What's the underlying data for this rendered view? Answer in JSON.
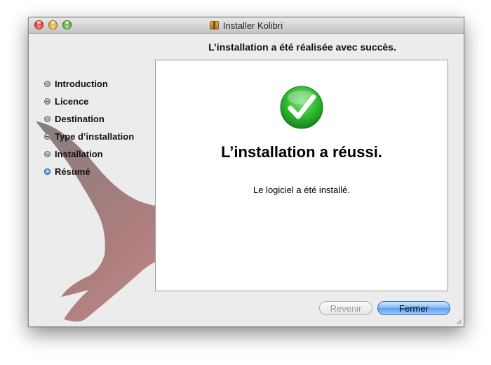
{
  "window": {
    "title": "Installer Kolibri",
    "title_icon": "package-icon"
  },
  "header": {
    "text": "L’installation a été réalisée avec succès."
  },
  "steps": [
    {
      "label": "Introduction",
      "state": "done"
    },
    {
      "label": "Licence",
      "state": "done"
    },
    {
      "label": "Destination",
      "state": "done"
    },
    {
      "label": "Type d’installation",
      "state": "done"
    },
    {
      "label": "Installation",
      "state": "done"
    },
    {
      "label": "Résumé",
      "state": "current"
    }
  ],
  "content": {
    "icon": "green-check-icon",
    "title": "L’installation a réussi.",
    "message": "Le logiciel a été installé."
  },
  "buttons": {
    "back_label": "Revenir",
    "close_label": "Fermer"
  },
  "colors": {
    "accent_blue": "#5d9fee",
    "success_green": "#2eb82e",
    "bird": "#a46a6a"
  }
}
